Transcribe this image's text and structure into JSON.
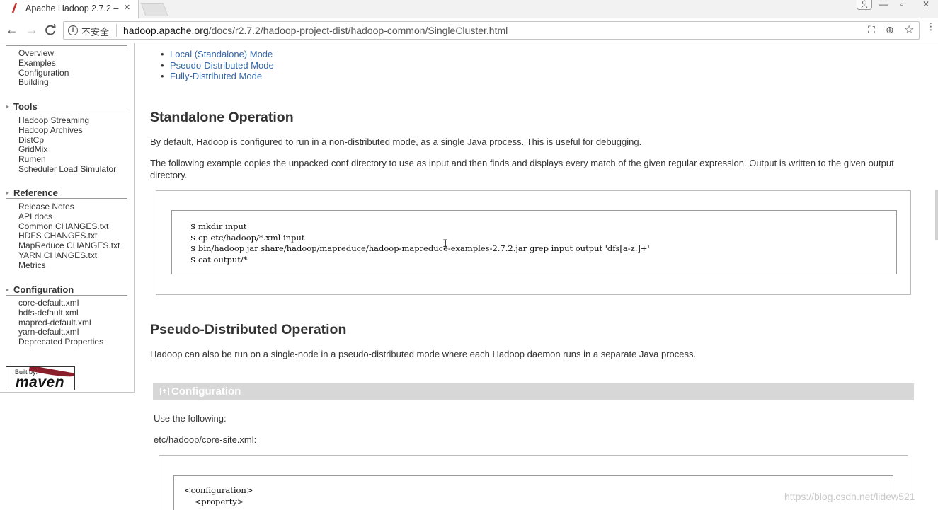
{
  "browser": {
    "tab_title": "Apache Hadoop 2.7.2 –",
    "tab_close": "×",
    "window_min": "—",
    "window_max": "▫",
    "window_close": "✕",
    "nav_back": "←",
    "nav_forward": "→",
    "nav_reload": "C",
    "security_label": "不安全",
    "url_host": "hadoop.apache.org",
    "url_path": "/docs/r2.7.2/hadoop-project-dist/hadoop-common/SingleCluster.html",
    "translate_icon_glyph": "⛶",
    "zoom_icon_glyph": "⊕",
    "star_glyph": "☆",
    "menu_glyph": "⋮"
  },
  "sidebar": {
    "top_items": [
      "Overview",
      "Examples",
      "Configuration",
      "Building"
    ],
    "sections": [
      {
        "title": "Tools",
        "items": [
          "Hadoop Streaming",
          "Hadoop Archives",
          "DistCp",
          "GridMix",
          "Rumen",
          "Scheduler Load Simulator"
        ]
      },
      {
        "title": "Reference",
        "items": [
          "Release Notes",
          "API docs",
          "Common CHANGES.txt",
          "HDFS CHANGES.txt",
          "MapReduce CHANGES.txt",
          "YARN CHANGES.txt",
          "Metrics"
        ]
      },
      {
        "title": "Configuration",
        "items": [
          "core-default.xml",
          "hdfs-default.xml",
          "mapred-default.xml",
          "yarn-default.xml",
          "Deprecated Properties"
        ]
      }
    ],
    "badge": {
      "built_by": "Built by:",
      "name": "maven"
    }
  },
  "main": {
    "modes": [
      "Local (Standalone) Mode",
      "Pseudo-Distributed Mode",
      "Fully-Distributed Mode"
    ],
    "standalone": {
      "heading": "Standalone Operation",
      "para1": "By default, Hadoop is configured to run in a non-distributed mode, as a single Java process. This is useful for debugging.",
      "para2": "The following example copies the unpacked conf directory to use as input and then finds and displays every match of the given regular expression. Output is written to the given output directory.",
      "code": [
        "$ mkdir input",
        "$ cp etc/hadoop/*.xml input",
        "$ bin/hadoop jar share/hadoop/mapreduce/hadoop-mapreduce-examples-2.7.2.jar grep input output 'dfs[a-z.]+'",
        "$ cat output/*"
      ]
    },
    "pseudo": {
      "heading": "Pseudo-Distributed Operation",
      "para": "Hadoop can also be run on a single-node in a pseudo-distributed mode where each Hadoop daemon runs in a separate Java process.",
      "section_title": "Configuration",
      "section_toggle": "+",
      "use_following": "Use the following:",
      "file_label": "etc/hadoop/core-site.xml:",
      "code": [
        "<configuration>",
        "    <property>"
      ]
    },
    "cursor_glyph": "I",
    "watermark": "https://blog.csdn.net/lidew521"
  }
}
